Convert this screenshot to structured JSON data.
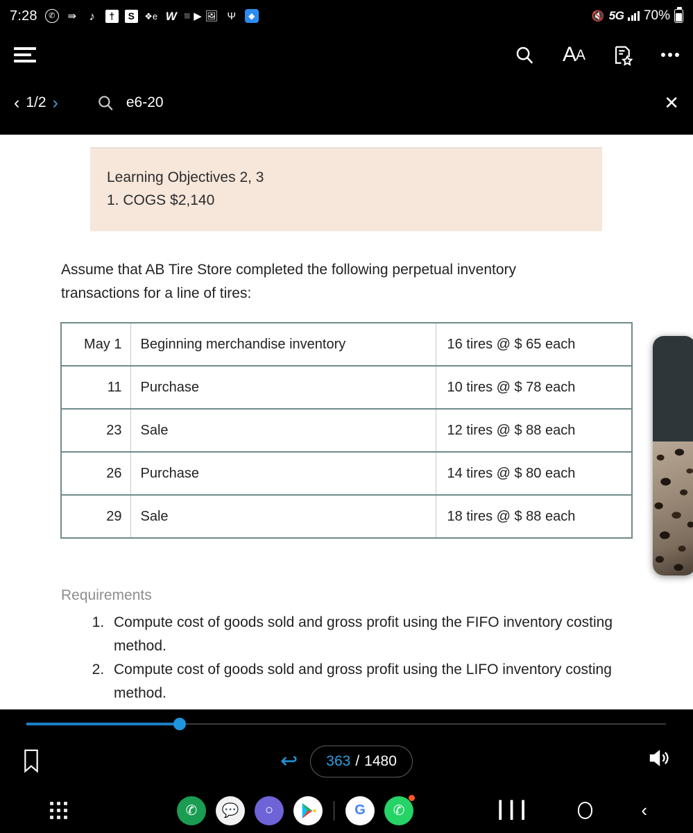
{
  "status_bar": {
    "time": "7:28",
    "icons": [
      "whatsapp-icon",
      "snapchat-icon",
      "tiktok-icon",
      "bible-icon",
      "s-app-icon",
      "e-app-icon",
      "word-icon",
      "video-camera-icon",
      "gallery-icon",
      "flashlight-icon",
      "blue-app-icon"
    ],
    "mute_icon": "mute-icon",
    "network": "5G",
    "battery_text": "70%"
  },
  "toolbar": {
    "menu_icon": "hamburger-menu-icon",
    "search_icon": "search-icon",
    "font_size_label": "A",
    "font_size_small": "A",
    "bookmark_icon": "bookmark-star-icon",
    "more_icon": "more-options-icon"
  },
  "search_bar": {
    "prev_arrow": "‹",
    "match_count": "1/2",
    "next_arrow": "›",
    "search_icon": "search-icon",
    "query": "e6-20",
    "close_label": "✕"
  },
  "document": {
    "callout": {
      "line1": "Learning Objectives 2, 3",
      "line2": "1. COGS $2,140",
      "bg_color": "#f7e7db"
    },
    "intro": "Assume that AB Tire Store completed the following perpetual inventory transactions for a line of tires:",
    "table": {
      "border_color": "#6f8a89",
      "rows": [
        {
          "date": "May 1",
          "description": "Beginning merchandise inventory",
          "quantity": "16 tires @ $ 65 each"
        },
        {
          "date": "11",
          "description": "Purchase",
          "quantity": "10 tires @ $ 78 each"
        },
        {
          "date": "23",
          "description": "Sale",
          "quantity": "12 tires @ $ 88 each"
        },
        {
          "date": "26",
          "description": "Purchase",
          "quantity": "14 tires @ $ 80 each"
        },
        {
          "date": "29",
          "description": "Sale",
          "quantity": "18 tires @ $ 88 each"
        }
      ]
    },
    "requirements_title": "Requirements",
    "requirements": [
      "Compute cost of goods sold and gross profit using the FIFO inventory costing method.",
      "Compute cost of goods sold and gross profit using the LIFO inventory costing method."
    ]
  },
  "bottom_bar": {
    "bookmark_icon": "bookmark-icon",
    "undo_icon": "undo-arrow-icon",
    "current_page": "363",
    "page_separator": "/",
    "total_pages": "1480",
    "speaker_icon": "speaker-icon",
    "accent_color": "#1f95dd"
  },
  "dock": {
    "drawer_icon": "app-drawer-icon",
    "apps": [
      "phone-app",
      "messages-app",
      "samsung-internet-app",
      "play-store-app",
      "google-app",
      "whatsapp-app"
    ],
    "recents_icon": "recents-icon",
    "home_icon": "home-icon",
    "back_icon": "back-icon"
  }
}
